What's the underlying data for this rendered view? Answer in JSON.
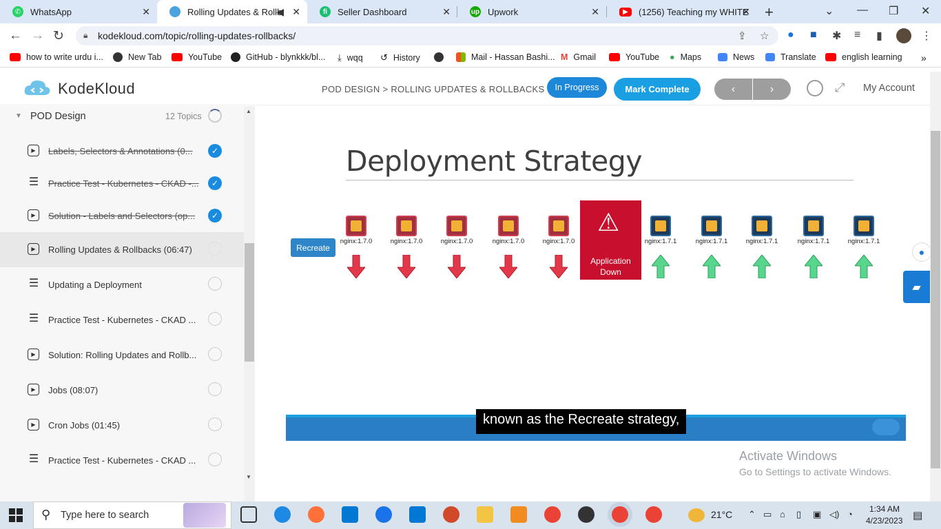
{
  "browser": {
    "tabs": [
      {
        "title": "WhatsApp",
        "color": "#25d366"
      },
      {
        "title": "Rolling Updates & Rollba",
        "color": "#4aa3df"
      },
      {
        "title": "Seller Dashboard",
        "color": "#1dbf73"
      },
      {
        "title": "Upwork",
        "color": "#14a800"
      },
      {
        "title": "(1256) Teaching my WHITE fr",
        "color": "#ff0000"
      }
    ],
    "url": "kodekloud.com/topic/rolling-updates-rollbacks/",
    "bookmarks": [
      {
        "label": "how to write urdu i...",
        "color": "#ff0000"
      },
      {
        "label": "New Tab",
        "color": "#333333"
      },
      {
        "label": "YouTube",
        "color": "#ff0000"
      },
      {
        "label": "GitHub - blynkkk/bl...",
        "color": "#222222"
      },
      {
        "label": "wqq",
        "color": "#444444"
      },
      {
        "label": "History",
        "color": "#444444"
      },
      {
        "label": "",
        "color": "#333333"
      },
      {
        "label": "Mail - Hassan Bashi...",
        "color": "#f25022"
      },
      {
        "label": "Gmail",
        "color": "#ea4335"
      },
      {
        "label": "YouTube",
        "color": "#ff0000"
      },
      {
        "label": "Maps",
        "color": "#34a853"
      },
      {
        "label": "News",
        "color": "#4285f4"
      },
      {
        "label": "Translate",
        "color": "#4285f4"
      },
      {
        "label": "english learning",
        "color": "#ff0000"
      }
    ]
  },
  "site": {
    "logo": "KodeKloud",
    "breadcrumb": "POD DESIGN > ROLLING UPDATES & ROLLBACKS",
    "in_progress": "In Progress",
    "mark_complete": "Mark Complete",
    "prev": "‹",
    "next": "›",
    "account": "My Account"
  },
  "sidebar": {
    "section": "POD Design",
    "count": "12 Topics",
    "items": [
      {
        "label": "Labels, Selectors & Annotations (0...",
        "icon": "video",
        "done": true
      },
      {
        "label": "Practice Test - Kubernetes - CKAD -...",
        "icon": "list",
        "done": true
      },
      {
        "label": "Solution - Labels and Selectors (op...",
        "icon": "video",
        "done": true
      },
      {
        "label": "Rolling Updates & Rollbacks (06:47)",
        "icon": "video",
        "done": false,
        "current": true
      },
      {
        "label": "Updating a Deployment",
        "icon": "list",
        "done": false
      },
      {
        "label": "Practice Test - Kubernetes - CKAD ...",
        "icon": "list",
        "done": false
      },
      {
        "label": "Solution: Rolling Updates and Rollb...",
        "icon": "video",
        "done": false
      },
      {
        "label": "Jobs (08:07)",
        "icon": "video",
        "done": false
      },
      {
        "label": "Cron Jobs (01:45)",
        "icon": "video",
        "done": false
      },
      {
        "label": "Practice Test - Kubernetes - CKAD ...",
        "icon": "list",
        "done": false
      }
    ]
  },
  "slide": {
    "title": "Deployment Strategy",
    "recreate": "Recreate",
    "old_label": "nginx:1.7.0",
    "new_label": "nginx:1.7.1",
    "app_down": "Application Down",
    "caption": "known as the Recreate strategy,"
  },
  "watermark": {
    "line1": "Activate Windows",
    "line2": "Go to Settings to activate Windows."
  },
  "taskbar": {
    "search": "Type here to search",
    "weather": "21°C",
    "time": "1:34 AM",
    "date": "4/23/2023"
  }
}
